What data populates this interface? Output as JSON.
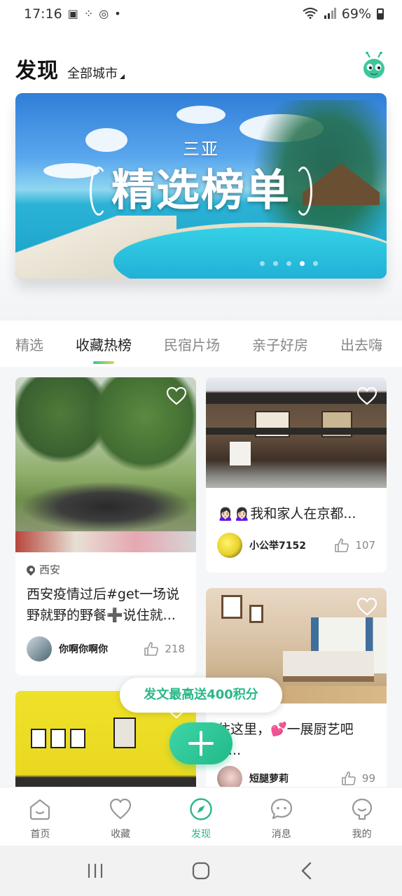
{
  "status_bar": {
    "time": "17:16",
    "battery": "69%"
  },
  "header": {
    "title": "发现",
    "city": "全部城市"
  },
  "banner": {
    "subtitle": "三亚",
    "title": "精选榜单",
    "slide_index": 3,
    "slide_count": 5
  },
  "tabs": [
    {
      "label": "精选"
    },
    {
      "label": "收藏热榜"
    },
    {
      "label": "民宿片场"
    },
    {
      "label": "亲子好房"
    },
    {
      "label": "出去嗨"
    }
  ],
  "feed": {
    "cards": [
      {
        "location": "西安",
        "text": "西安疫情过后#get一场说野就野的野餐➕说住就...",
        "user": "你啊你啊你",
        "likes": "218"
      },
      {
        "text": "🙍🏻‍♀️🙍🏻‍♀️我和家人在京都...",
        "user": "小公举7152",
        "likes": "107"
      },
      {
        "text": "住这里，💕一展厨艺吧~...",
        "user": "短腿萝莉",
        "likes": "99"
      },
      {}
    ]
  },
  "promo": {
    "label": "发文最高送400积分"
  },
  "bottom_nav": [
    {
      "label": "首页"
    },
    {
      "label": "收藏"
    },
    {
      "label": "发现"
    },
    {
      "label": "消息"
    },
    {
      "label": "我的"
    }
  ],
  "colors": {
    "accent": "#2bb889"
  }
}
